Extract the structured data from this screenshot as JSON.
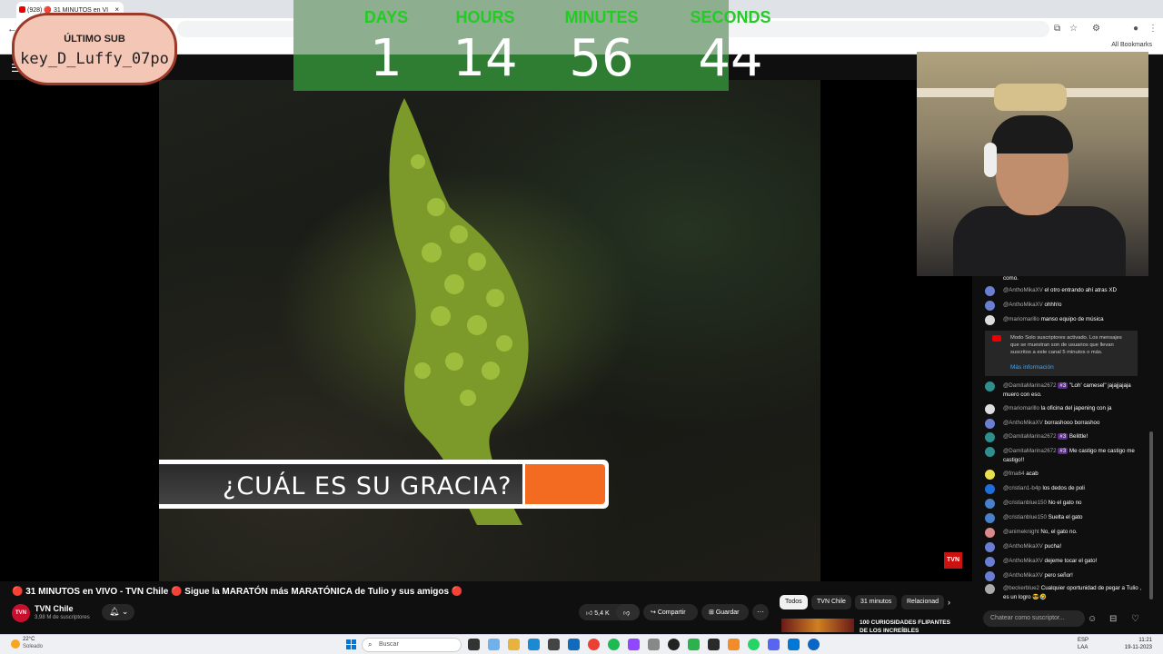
{
  "browser": {
    "tab_title": "(928) 🔴 31 MINUTOS en VI",
    "tab_close": "×",
    "bookmarks_label": "All Bookmarks"
  },
  "sub_badge": {
    "title": "ÚLTIMO SUB",
    "name": "key_D_Luffy_07po"
  },
  "countdown": {
    "units": [
      {
        "label": "DAYS",
        "value": "1"
      },
      {
        "label": "HOURS",
        "value": "14"
      },
      {
        "label": "MINUTES",
        "value": "56"
      },
      {
        "label": "SECONDS",
        "value": "44"
      }
    ]
  },
  "video": {
    "caption": "¿CUÁL ES SU GRACIA?",
    "watermark": "TVN",
    "title": "🔴 31 MINUTOS en VIVO - TVN Chile 🔴 Sigue la MARATÓN más MARATÓNICA de Tulio y sus amigos 🔴"
  },
  "channel": {
    "avatar_text": "TVN",
    "name": "TVN Chile",
    "subscribers": "3,98 M de suscriptores"
  },
  "actions": {
    "likes": "5,4 K",
    "share": "Compartir",
    "save": "Guardar",
    "more": "···"
  },
  "chips": [
    "Todos",
    "TVN Chile",
    "31 minutos",
    "Relacionad"
  ],
  "recommendation": {
    "title": "100 CURIOSIDADES FLIPANTES DE LOS INCREÍBLES"
  },
  "chat": {
    "messages": [
      {
        "author": "",
        "text": "como.",
        "color": "#666"
      },
      {
        "author": "@AnthoMikaXV",
        "text": "el otro entrando ahí atras XD",
        "color": "#6a7fd1"
      },
      {
        "author": "@AnthoMikaXV",
        "text": "ohhh!o",
        "color": "#6a7fd1"
      },
      {
        "author": "@mariomarillo",
        "text": "manso equipo de música",
        "color": "#ddd"
      },
      {
        "author": "@DamitaMarina2672",
        "badge": "#3",
        "text": "\"Loh' camesel\" jajajjajaja muero con eso.",
        "color": "#2f8f8f"
      },
      {
        "author": "@mariomarillo",
        "text": "la oficina del japening con ja",
        "color": "#ddd"
      },
      {
        "author": "@AnthoMikaXV",
        "text": "borrashooo borrashoo",
        "color": "#6a7fd1"
      },
      {
        "author": "@DamitaMarina2672",
        "badge": "#3",
        "text": "Belittle!",
        "color": "#2f8f8f"
      },
      {
        "author": "@DamitaMarina2672",
        "badge": "#3",
        "text": "Me castigo me castigo me castigo!!",
        "color": "#2f8f8f"
      },
      {
        "author": "@fma64",
        "text": "acab",
        "color": "#e8e050"
      },
      {
        "author": "@cristian1-b4p",
        "text": "los dedos de poli",
        "color": "#1e6fd9"
      },
      {
        "author": "@cristianblue150",
        "text": "No el gato no",
        "color": "#4a7fc9"
      },
      {
        "author": "@cristianblue150",
        "text": "Suelta el gato",
        "color": "#4a7fc9"
      },
      {
        "author": "@animeknight",
        "text": "No, el gato no.",
        "color": "#d98a8a"
      },
      {
        "author": "@AnthoMikaXV",
        "text": "pucha!",
        "color": "#6a7fd1"
      },
      {
        "author": "@AnthoMikaXV",
        "text": "dejeme tocar el gato!",
        "color": "#6a7fd1"
      },
      {
        "author": "@AnthoMikaXV",
        "text": "pero señor!",
        "color": "#6a7fd1"
      },
      {
        "author": "@beckerblue2",
        "text": "Cualquier oportunidad de pegar a Tulio , es un logro 😎🤣",
        "color": "#aaa"
      }
    ],
    "notice": "Modo Solo suscriptores activado. Los mensajes que se muestran son de usuarios que llevan suscritos a este canal 5 minutos o más.",
    "notice_link": "Más información",
    "input_placeholder": "Chatear como suscriptor..."
  },
  "taskbar": {
    "temp": "22°C",
    "weather": "Soleado",
    "search": "Buscar",
    "lang1": "ESP",
    "lang2": "LAA",
    "time": "11:21",
    "date": "19-11-2023"
  }
}
